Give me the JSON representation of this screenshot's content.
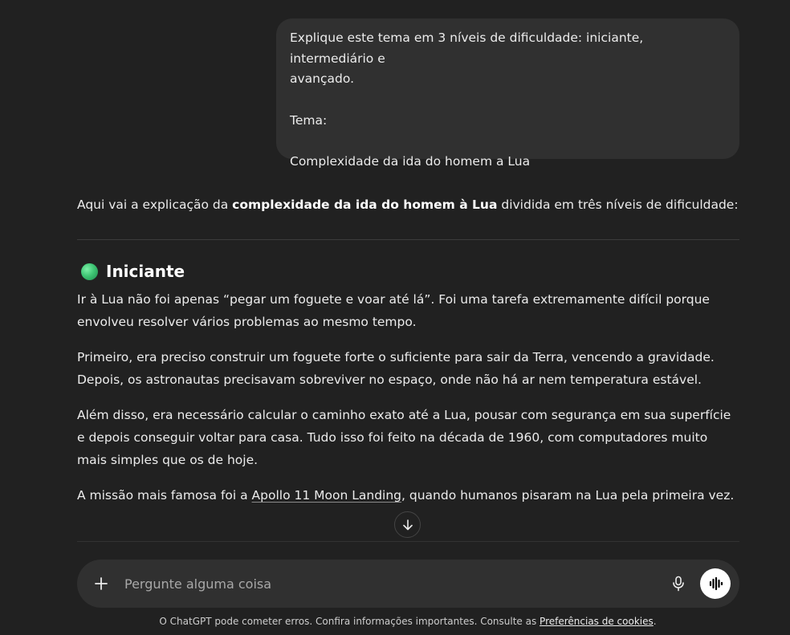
{
  "user_message": {
    "line1": "Explique este tema em 3 níveis de dificuldade: iniciante, intermediário e",
    "line2": "avançado.",
    "line3": "Tema:",
    "line4": "Complexidade da ida do homem a Lua"
  },
  "assistant": {
    "intro_prefix": "Aqui vai a explicação da ",
    "intro_bold": "complexidade da ida do homem à Lua",
    "intro_suffix": " dividida em três níveis de dificuldade:",
    "section_title": "Iniciante",
    "section_icon": "green-circle-emoji",
    "para1": "Ir à Lua não foi apenas “pegar um foguete e voar até lá”. Foi uma tarefa extremamente difícil porque envolveu resolver vários problemas ao mesmo tempo.",
    "para2": "Primeiro, era preciso construir um foguete forte o suficiente para sair da Terra, vencendo a gravidade. Depois, os astronautas precisavam sobreviver no espaço, onde não há ar nem temperatura estável.",
    "para3": "Além disso, era necessário calcular o caminho exato até a Lua, pousar com segurança em sua superfície e depois conseguir voltar para casa. Tudo isso foi feito na década de 1960, com computadores muito mais simples que os de hoje.",
    "para4_prefix": "A missão mais famosa foi a ",
    "para4_link": "Apollo 11 Moon Landing",
    "para4_suffix": ", quando humanos pisaram na Lua pela primeira vez."
  },
  "composer": {
    "placeholder": "Pergunte alguma coisa",
    "plus_icon": "plus-icon",
    "mic_icon": "microphone-icon",
    "voice_icon": "voice-mode-icon"
  },
  "footer": {
    "text": "O ChatGPT pode cometer erros. Confira informações importantes. Consulte as ",
    "link": "Preferências de cookies",
    "end": "."
  }
}
